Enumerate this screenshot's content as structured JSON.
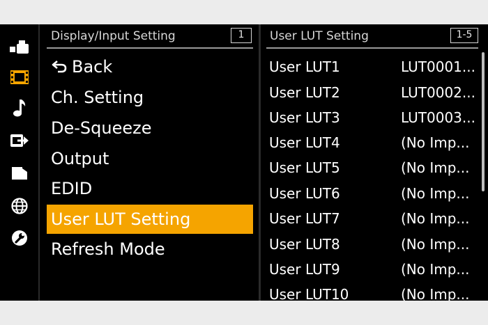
{
  "colors": {
    "screen_bg": "#000000",
    "selected_bg": "#f5a400",
    "text": "#ffffff"
  },
  "rail": {
    "icons": [
      "camera-icon",
      "film-icon",
      "music-note-icon",
      "output-icon",
      "folder-icon",
      "globe-icon",
      "wrench-icon"
    ],
    "active_icon": "film-icon"
  },
  "menu": {
    "title": "Display/Input Setting",
    "page": "1",
    "items": [
      {
        "label": "Back",
        "icon": "back-arrow-icon"
      },
      {
        "label": "Ch. Setting"
      },
      {
        "label": "De-Squeeze"
      },
      {
        "label": "Output"
      },
      {
        "label": "EDID"
      },
      {
        "label": "User LUT Setting",
        "selected": true
      },
      {
        "label": "Refresh Mode"
      }
    ]
  },
  "list": {
    "title": "User LUT Setting",
    "page": "1-5",
    "rows": [
      {
        "name": "User LUT1",
        "value": "LUT0001..."
      },
      {
        "name": "User LUT2",
        "value": "LUT0002..."
      },
      {
        "name": "User LUT3",
        "value": "LUT0003..."
      },
      {
        "name": "User LUT4",
        "value": "(No Imp..."
      },
      {
        "name": "User LUT5",
        "value": "(No Imp..."
      },
      {
        "name": "User LUT6",
        "value": "(No Imp..."
      },
      {
        "name": "User LUT7",
        "value": "(No Imp..."
      },
      {
        "name": "User LUT8",
        "value": "(No Imp..."
      },
      {
        "name": "User LUT9",
        "value": "(No Imp..."
      },
      {
        "name": "User LUT10",
        "value": "(No Imp..."
      }
    ]
  }
}
